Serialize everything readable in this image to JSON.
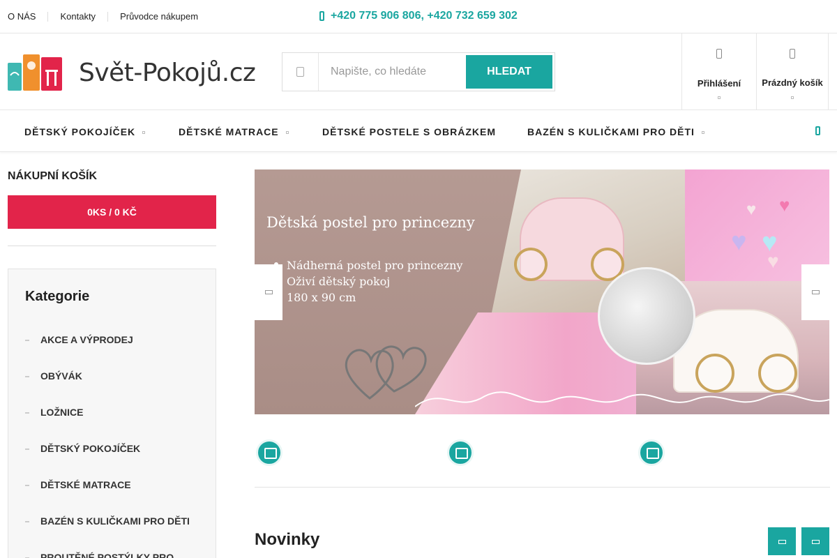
{
  "topbar": {
    "links": [
      "O NÁS",
      "Kontakty",
      "Průvodce nákupem"
    ],
    "phone": "+420 775 906 806, +420 732 659 302"
  },
  "header": {
    "logo_text": "Svět-Pokojů.cz",
    "search": {
      "placeholder": "Napište, co hledáte",
      "button": "HLEDAT"
    },
    "login_label": "Přihlášení",
    "cart_label": "Prázdný košík"
  },
  "nav": {
    "items": [
      "DĚTSKÝ POKOJÍČEK",
      "DĚTSKÉ MATRACE",
      "DĚTSKÉ POSTELE S OBRÁZKEM",
      "BAZÉN S KULIČKAMI PRO DĚTI"
    ]
  },
  "sidebar": {
    "cart_title": "NÁKUPNÍ KOŠÍK",
    "cart_summary": "0KS / 0 KČ",
    "categories_title": "Kategorie",
    "categories": [
      "AKCE A VÝPRODEJ",
      "OBÝVÁK",
      "LOŽNICE",
      "DĚTSKÝ POKOJÍČEK",
      "DĚTSKÉ MATRACE",
      "BAZÉN S KULIČKAMI PRO DĚTI",
      "PROUTĚNÉ POSTÝLKY PRO"
    ]
  },
  "banner": {
    "title": "Dětská postel pro princezny",
    "lines": [
      "Nádherná postel pro princezny",
      "Oživí dětský pokoj",
      "180 x 90 cm"
    ]
  },
  "main": {
    "section_title": "Novinky"
  },
  "colors": {
    "accent": "#1aa6a0",
    "cart": "#e2244a"
  }
}
